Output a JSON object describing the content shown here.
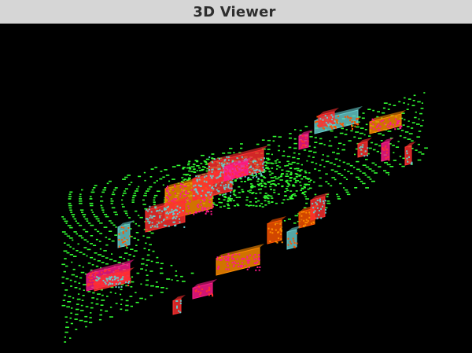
{
  "window": {
    "title": "3D Viewer"
  },
  "scene": {
    "background_color": "#000000",
    "ground_points_color": "#33ff33",
    "box_colors": [
      "#ff8c00",
      "#ff1a8c",
      "#ff3030",
      "#66cccc",
      "#ff5500"
    ]
  }
}
